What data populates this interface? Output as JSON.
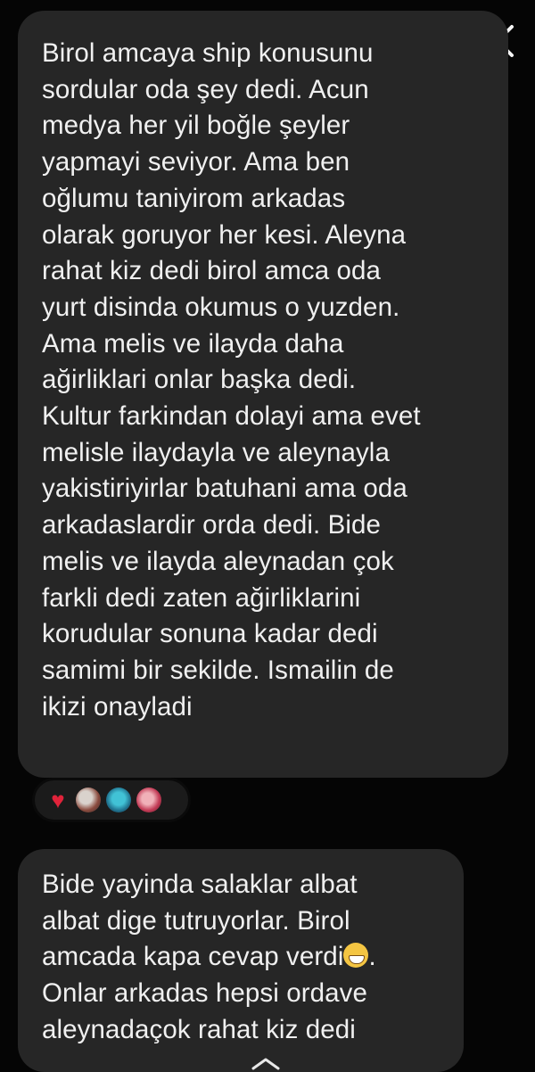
{
  "messages": [
    {
      "text": "Birol amcaya ship konusunu\nsordular oda şey dedi. Acun\nmedya her yil boğle şeyler\nyapmayi seviyor. Ama ben\noğlumu taniyirom arkadas\nolarak goruyor her kesi. Aleyna\nrahat kiz dedi birol amca oda\nyurt disinda okumus o yuzden.\nAma melis ve ilayda daha\nağirliklari onlar başka dedi.\nKultur farkindan dolayi ama evet\nmelisle ilaydayla ve aleynayla\nyakistiriyirlar batuhani ama oda\narkadaslardir orda dedi. Bide\nmelis ve ilayda aleynadan çok\nfarkli dedi zaten ağirliklarini\nkorudular sonuna kadar dedi\nsamimi bir sekilde. Ismailin de\nikizi onayladi",
      "reactions": [
        "heart",
        "avatar",
        "avatar",
        "avatar"
      ]
    },
    {
      "text_before_emoji": "Bide yayinda salaklar albat\nalbat dige tutruyorlar. Birol\namcada kapa cevap verdi",
      "emoji": "grinning-face",
      "text_after_emoji": ".\nOnlar arkadas hepsi ordave\naleynadaçok rahat kiz dedi"
    }
  ],
  "icons": {
    "close": "close-icon",
    "heart": "heart-icon",
    "home": "home-indicator-icon"
  },
  "colors": {
    "background": "#050505",
    "bubble": "#262626",
    "text": "#f0f0f0",
    "heart": "#e0233a"
  }
}
